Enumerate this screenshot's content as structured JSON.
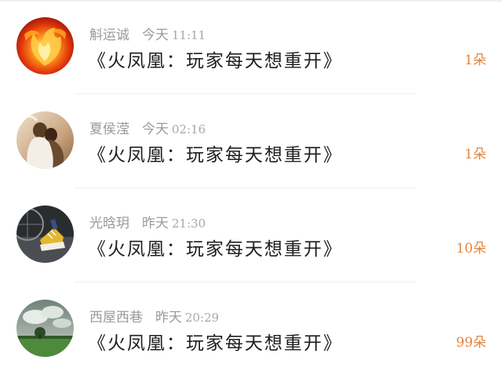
{
  "items": [
    {
      "avatar_icon": "phoenix-avatar-icon",
      "name": "斛运诚",
      "day": "今天",
      "time": "11:11",
      "title": "《火凤凰：玩家每天想重开》",
      "count": "1朵"
    },
    {
      "avatar_icon": "couple-photo-avatar-icon",
      "name": "夏侯滢",
      "day": "今天",
      "time": "02:16",
      "title": "《火凤凰：玩家每天想重开》",
      "count": "1朵"
    },
    {
      "avatar_icon": "sneaker-avatar-icon",
      "name": "光晗玥",
      "day": "昨天",
      "time": "21:30",
      "title": "《火凤凰：玩家每天想重开》",
      "count": "10朵"
    },
    {
      "avatar_icon": "landscape-avatar-icon",
      "name": "西屋西巷",
      "day": "昨天",
      "time": "20:29",
      "title": "《火凤凰：玩家每天想重开》",
      "count": "99朵"
    }
  ],
  "colors": {
    "accent": "#e5843c",
    "meta_text": "#9a9a9a",
    "title_text": "#1e1e1e"
  }
}
